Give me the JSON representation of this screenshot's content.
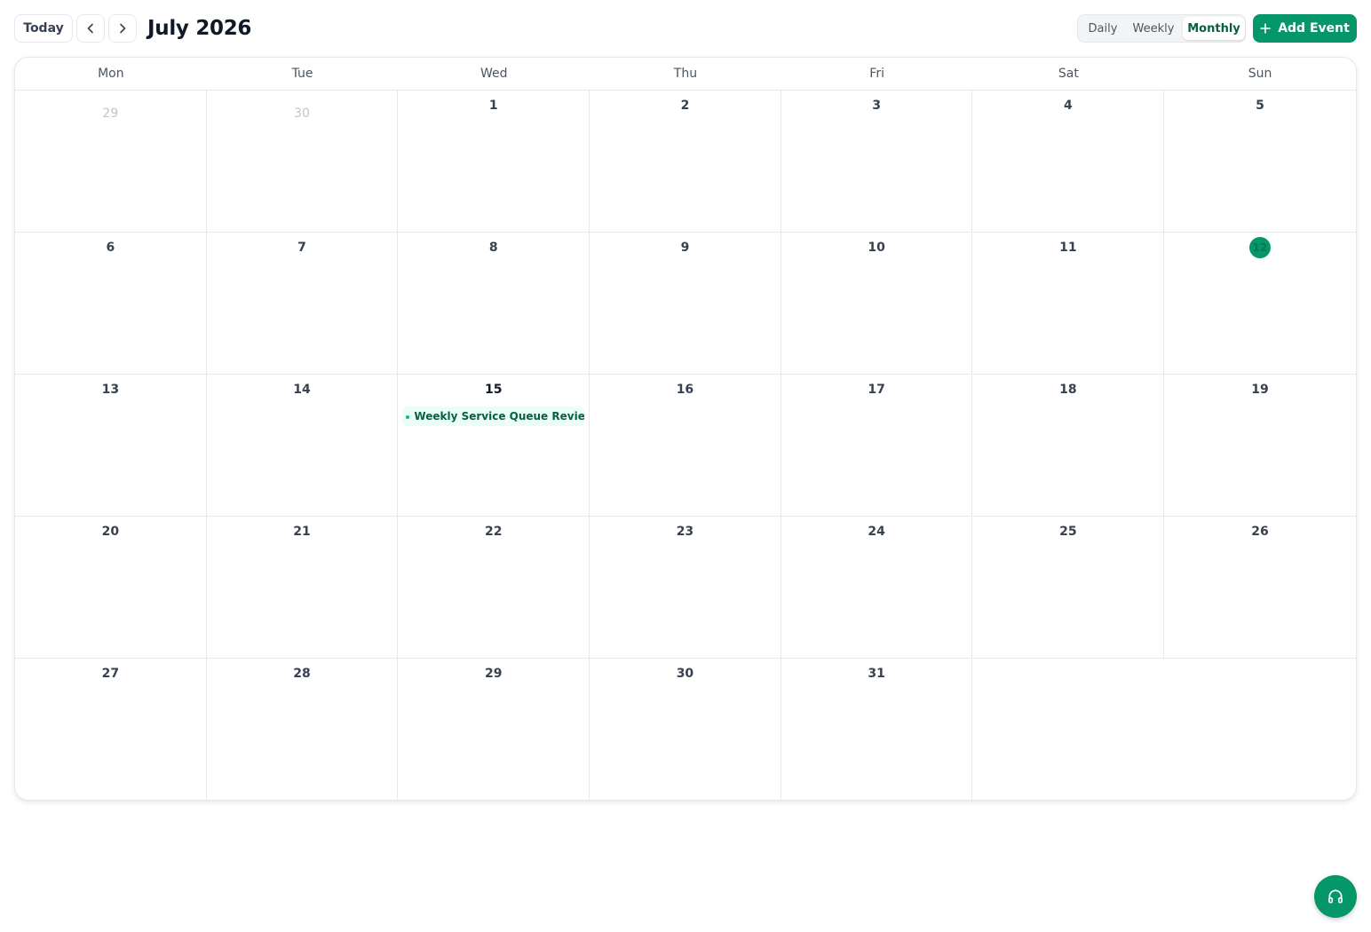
{
  "toolbar": {
    "today_label": "Today",
    "month_title": "July 2026",
    "views": [
      "Daily",
      "Weekly",
      "Monthly"
    ],
    "active_view": "Monthly",
    "add_event_label": "Add Event"
  },
  "calendar": {
    "weekdays": [
      "Mon",
      "Tue",
      "Wed",
      "Thu",
      "Fri",
      "Sat",
      "Sun"
    ],
    "weeks": [
      [
        "29",
        "30",
        "1",
        "2",
        "3",
        "4",
        "5"
      ],
      [
        "6",
        "7",
        "8",
        "9",
        "10",
        "11",
        "12"
      ],
      [
        "13",
        "14",
        "15",
        "16",
        "17",
        "18",
        "19"
      ],
      [
        "20",
        "21",
        "22",
        "23",
        "24",
        "25",
        "26"
      ],
      [
        "27",
        "28",
        "29",
        "30",
        "31"
      ]
    ],
    "outside_days": [
      "29",
      "30"
    ],
    "today": "12",
    "selected_day": "15",
    "events": [
      {
        "day": "15",
        "title": "Weekly Service Queue Review — ..."
      }
    ]
  },
  "colors": {
    "accent": "#059669",
    "accent_dark": "#065f46",
    "event_bg": "#ecfdf5"
  },
  "icons": {
    "prev": "chevron-left-icon",
    "next": "chevron-right-icon",
    "add": "plus-icon",
    "support": "headphones-icon"
  }
}
